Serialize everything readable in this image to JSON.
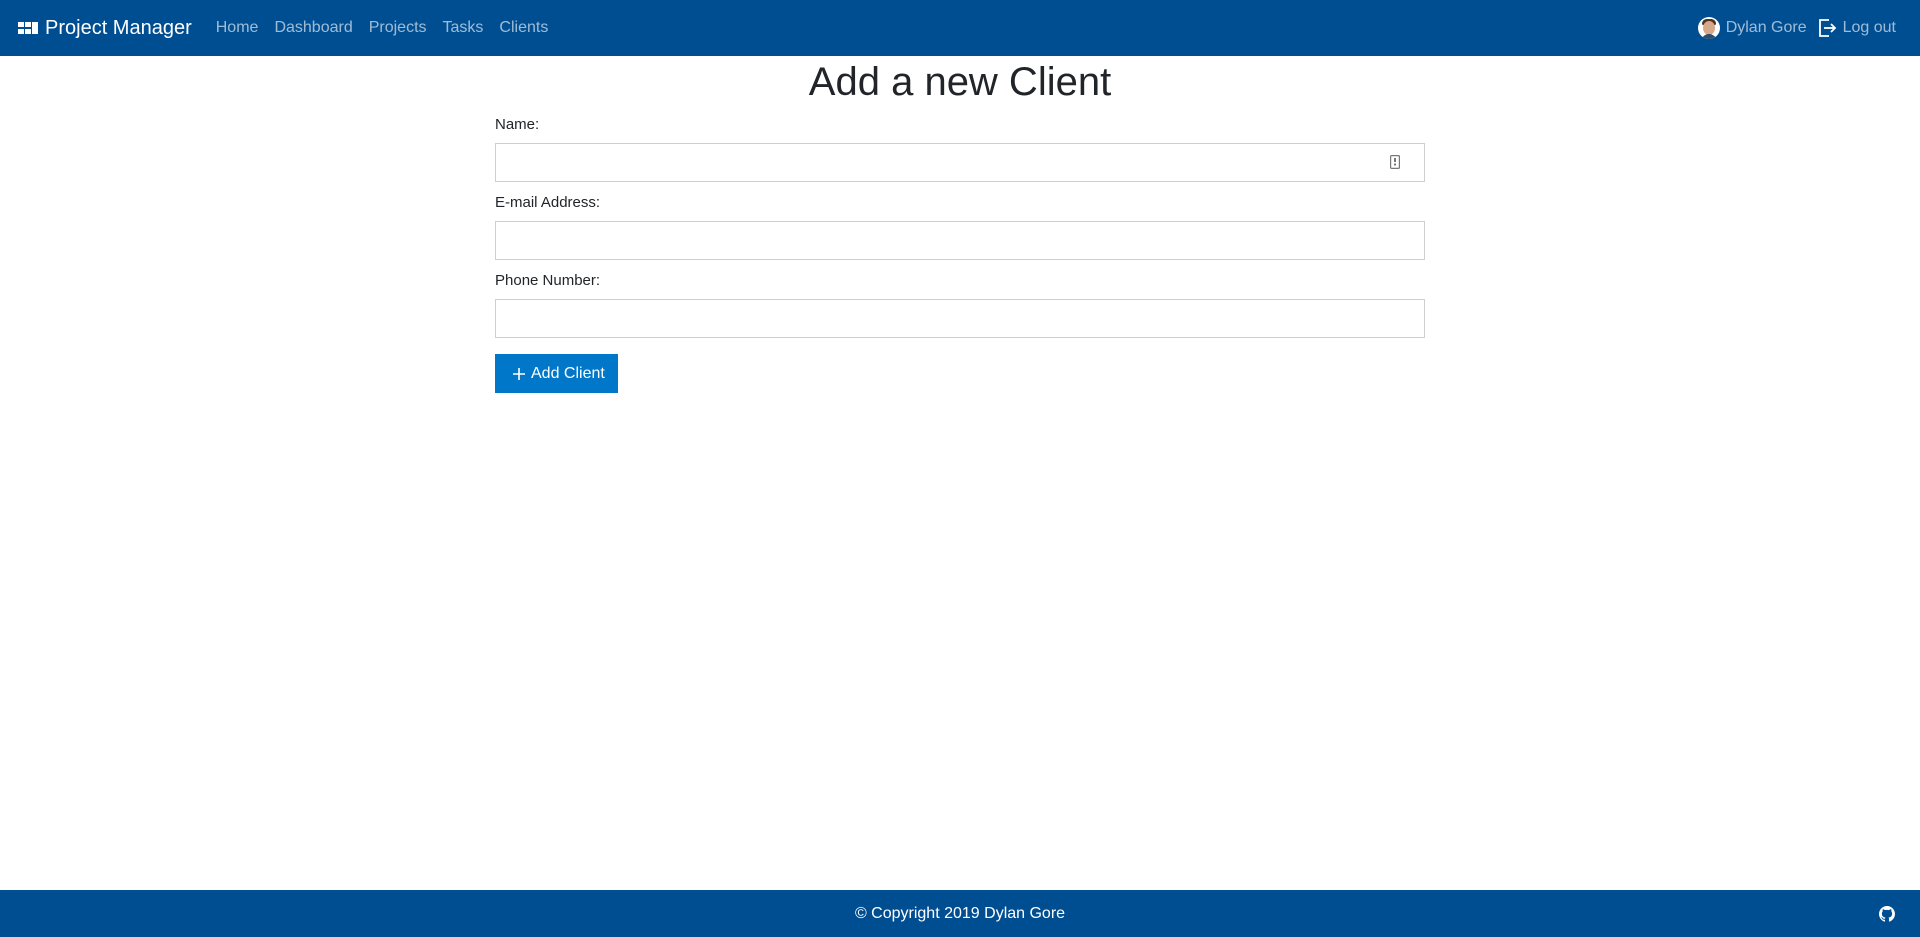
{
  "navbar": {
    "brand": "Project Manager",
    "brand_icon": "dashboard-icon",
    "links": [
      "Home",
      "Dashboard",
      "Projects",
      "Tasks",
      "Clients"
    ],
    "user_name": "Dylan Gore",
    "logout": "Log out",
    "logout_icon": "logout-icon",
    "color": "#004e92"
  },
  "page": {
    "title": "Add a new Client"
  },
  "form": {
    "name_label": "Name:",
    "name_value": "",
    "email_label": "E-mail Address:",
    "email_value": "",
    "phone_label": "Phone Number:",
    "phone_value": "",
    "submit_label": "Add Client",
    "submit_icon": "plus-icon",
    "button_color": "#0077c8"
  },
  "footer": {
    "text": "© Copyright 2019 Dylan Gore",
    "icon": "github-icon"
  }
}
